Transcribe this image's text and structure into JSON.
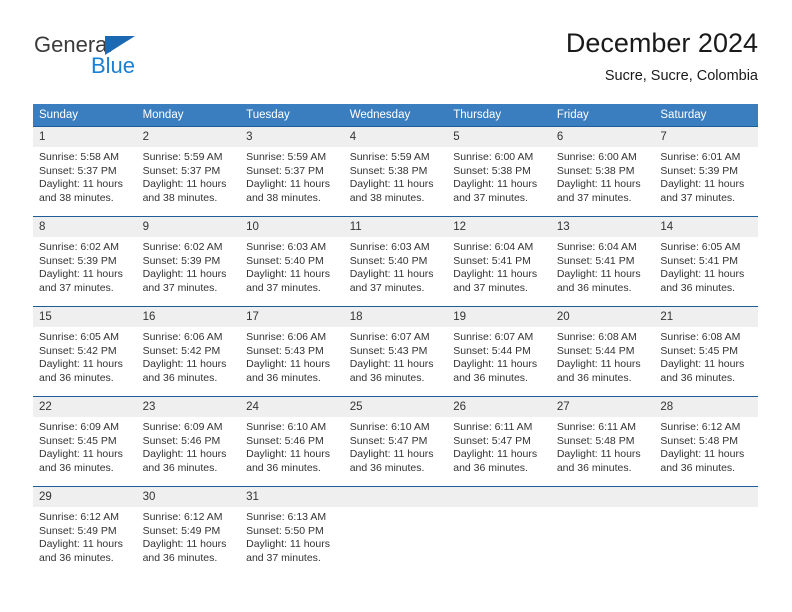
{
  "brand": {
    "name_top": "General",
    "name_bottom": "Blue",
    "accent_color": "#1b68b3",
    "blue_text_color": "#1b7fd4"
  },
  "header": {
    "title": "December 2024",
    "subtitle": "Sucre, Sucre, Colombia"
  },
  "theme": {
    "header_bg": "#3a7ebf",
    "row_rule": "#1f5c99",
    "daynum_bg": "#efefef"
  },
  "calendar": {
    "weekday_headers": [
      "Sunday",
      "Monday",
      "Tuesday",
      "Wednesday",
      "Thursday",
      "Friday",
      "Saturday"
    ],
    "weeks": [
      [
        {
          "day": "1",
          "sunrise": "Sunrise: 5:58 AM",
          "sunset": "Sunset: 5:37 PM",
          "daylight_line1": "Daylight: 11 hours",
          "daylight_line2": "and 38 minutes."
        },
        {
          "day": "2",
          "sunrise": "Sunrise: 5:59 AM",
          "sunset": "Sunset: 5:37 PM",
          "daylight_line1": "Daylight: 11 hours",
          "daylight_line2": "and 38 minutes."
        },
        {
          "day": "3",
          "sunrise": "Sunrise: 5:59 AM",
          "sunset": "Sunset: 5:37 PM",
          "daylight_line1": "Daylight: 11 hours",
          "daylight_line2": "and 38 minutes."
        },
        {
          "day": "4",
          "sunrise": "Sunrise: 5:59 AM",
          "sunset": "Sunset: 5:38 PM",
          "daylight_line1": "Daylight: 11 hours",
          "daylight_line2": "and 38 minutes."
        },
        {
          "day": "5",
          "sunrise": "Sunrise: 6:00 AM",
          "sunset": "Sunset: 5:38 PM",
          "daylight_line1": "Daylight: 11 hours",
          "daylight_line2": "and 37 minutes."
        },
        {
          "day": "6",
          "sunrise": "Sunrise: 6:00 AM",
          "sunset": "Sunset: 5:38 PM",
          "daylight_line1": "Daylight: 11 hours",
          "daylight_line2": "and 37 minutes."
        },
        {
          "day": "7",
          "sunrise": "Sunrise: 6:01 AM",
          "sunset": "Sunset: 5:39 PM",
          "daylight_line1": "Daylight: 11 hours",
          "daylight_line2": "and 37 minutes."
        }
      ],
      [
        {
          "day": "8",
          "sunrise": "Sunrise: 6:02 AM",
          "sunset": "Sunset: 5:39 PM",
          "daylight_line1": "Daylight: 11 hours",
          "daylight_line2": "and 37 minutes."
        },
        {
          "day": "9",
          "sunrise": "Sunrise: 6:02 AM",
          "sunset": "Sunset: 5:39 PM",
          "daylight_line1": "Daylight: 11 hours",
          "daylight_line2": "and 37 minutes."
        },
        {
          "day": "10",
          "sunrise": "Sunrise: 6:03 AM",
          "sunset": "Sunset: 5:40 PM",
          "daylight_line1": "Daylight: 11 hours",
          "daylight_line2": "and 37 minutes."
        },
        {
          "day": "11",
          "sunrise": "Sunrise: 6:03 AM",
          "sunset": "Sunset: 5:40 PM",
          "daylight_line1": "Daylight: 11 hours",
          "daylight_line2": "and 37 minutes."
        },
        {
          "day": "12",
          "sunrise": "Sunrise: 6:04 AM",
          "sunset": "Sunset: 5:41 PM",
          "daylight_line1": "Daylight: 11 hours",
          "daylight_line2": "and 37 minutes."
        },
        {
          "day": "13",
          "sunrise": "Sunrise: 6:04 AM",
          "sunset": "Sunset: 5:41 PM",
          "daylight_line1": "Daylight: 11 hours",
          "daylight_line2": "and 36 minutes."
        },
        {
          "day": "14",
          "sunrise": "Sunrise: 6:05 AM",
          "sunset": "Sunset: 5:41 PM",
          "daylight_line1": "Daylight: 11 hours",
          "daylight_line2": "and 36 minutes."
        }
      ],
      [
        {
          "day": "15",
          "sunrise": "Sunrise: 6:05 AM",
          "sunset": "Sunset: 5:42 PM",
          "daylight_line1": "Daylight: 11 hours",
          "daylight_line2": "and 36 minutes."
        },
        {
          "day": "16",
          "sunrise": "Sunrise: 6:06 AM",
          "sunset": "Sunset: 5:42 PM",
          "daylight_line1": "Daylight: 11 hours",
          "daylight_line2": "and 36 minutes."
        },
        {
          "day": "17",
          "sunrise": "Sunrise: 6:06 AM",
          "sunset": "Sunset: 5:43 PM",
          "daylight_line1": "Daylight: 11 hours",
          "daylight_line2": "and 36 minutes."
        },
        {
          "day": "18",
          "sunrise": "Sunrise: 6:07 AM",
          "sunset": "Sunset: 5:43 PM",
          "daylight_line1": "Daylight: 11 hours",
          "daylight_line2": "and 36 minutes."
        },
        {
          "day": "19",
          "sunrise": "Sunrise: 6:07 AM",
          "sunset": "Sunset: 5:44 PM",
          "daylight_line1": "Daylight: 11 hours",
          "daylight_line2": "and 36 minutes."
        },
        {
          "day": "20",
          "sunrise": "Sunrise: 6:08 AM",
          "sunset": "Sunset: 5:44 PM",
          "daylight_line1": "Daylight: 11 hours",
          "daylight_line2": "and 36 minutes."
        },
        {
          "day": "21",
          "sunrise": "Sunrise: 6:08 AM",
          "sunset": "Sunset: 5:45 PM",
          "daylight_line1": "Daylight: 11 hours",
          "daylight_line2": "and 36 minutes."
        }
      ],
      [
        {
          "day": "22",
          "sunrise": "Sunrise: 6:09 AM",
          "sunset": "Sunset: 5:45 PM",
          "daylight_line1": "Daylight: 11 hours",
          "daylight_line2": "and 36 minutes."
        },
        {
          "day": "23",
          "sunrise": "Sunrise: 6:09 AM",
          "sunset": "Sunset: 5:46 PM",
          "daylight_line1": "Daylight: 11 hours",
          "daylight_line2": "and 36 minutes."
        },
        {
          "day": "24",
          "sunrise": "Sunrise: 6:10 AM",
          "sunset": "Sunset: 5:46 PM",
          "daylight_line1": "Daylight: 11 hours",
          "daylight_line2": "and 36 minutes."
        },
        {
          "day": "25",
          "sunrise": "Sunrise: 6:10 AM",
          "sunset": "Sunset: 5:47 PM",
          "daylight_line1": "Daylight: 11 hours",
          "daylight_line2": "and 36 minutes."
        },
        {
          "day": "26",
          "sunrise": "Sunrise: 6:11 AM",
          "sunset": "Sunset: 5:47 PM",
          "daylight_line1": "Daylight: 11 hours",
          "daylight_line2": "and 36 minutes."
        },
        {
          "day": "27",
          "sunrise": "Sunrise: 6:11 AM",
          "sunset": "Sunset: 5:48 PM",
          "daylight_line1": "Daylight: 11 hours",
          "daylight_line2": "and 36 minutes."
        },
        {
          "day": "28",
          "sunrise": "Sunrise: 6:12 AM",
          "sunset": "Sunset: 5:48 PM",
          "daylight_line1": "Daylight: 11 hours",
          "daylight_line2": "and 36 minutes."
        }
      ],
      [
        {
          "day": "29",
          "sunrise": "Sunrise: 6:12 AM",
          "sunset": "Sunset: 5:49 PM",
          "daylight_line1": "Daylight: 11 hours",
          "daylight_line2": "and 36 minutes."
        },
        {
          "day": "30",
          "sunrise": "Sunrise: 6:12 AM",
          "sunset": "Sunset: 5:49 PM",
          "daylight_line1": "Daylight: 11 hours",
          "daylight_line2": "and 36 minutes."
        },
        {
          "day": "31",
          "sunrise": "Sunrise: 6:13 AM",
          "sunset": "Sunset: 5:50 PM",
          "daylight_line1": "Daylight: 11 hours",
          "daylight_line2": "and 37 minutes."
        },
        {
          "day": "",
          "sunrise": "",
          "sunset": "",
          "daylight_line1": "",
          "daylight_line2": ""
        },
        {
          "day": "",
          "sunrise": "",
          "sunset": "",
          "daylight_line1": "",
          "daylight_line2": ""
        },
        {
          "day": "",
          "sunrise": "",
          "sunset": "",
          "daylight_line1": "",
          "daylight_line2": ""
        },
        {
          "day": "",
          "sunrise": "",
          "sunset": "",
          "daylight_line1": "",
          "daylight_line2": ""
        }
      ]
    ]
  }
}
